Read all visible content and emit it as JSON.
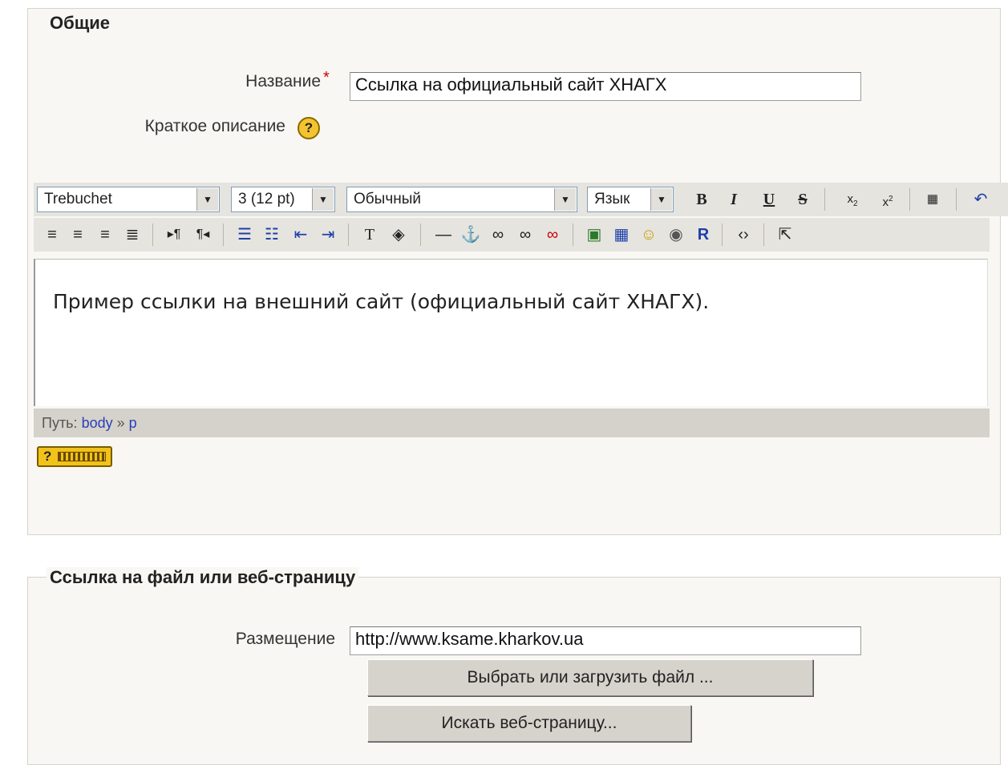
{
  "general": {
    "legend": "Общие",
    "name_label": "Название",
    "required_mark": "*",
    "name_value": "Ссылка на официальный сайт ХНАГХ",
    "summary_label": "Краткое описание",
    "help_glyph": "?"
  },
  "editor": {
    "font_family": "Trebuchet",
    "font_size": "3 (12 pt)",
    "format": "Обычный",
    "language": "Язык",
    "content": "Пример ссылки на внешний сайт (официальный сайт ХНАГХ).",
    "path_label": "Путь:",
    "path_body": "body",
    "path_sep": "»",
    "path_p": "p",
    "toolbar1_icons": [
      "bold-icon",
      "italic-icon",
      "underline-icon",
      "strikethrough-icon",
      "subscript-icon",
      "superscript-icon",
      "paste-word-icon",
      "undo-icon"
    ],
    "toolbar2_icons": [
      "align-left-icon",
      "align-center-icon",
      "align-right-icon",
      "justify-icon",
      "ltr-icon",
      "rtl-icon",
      "ordered-list-icon",
      "unordered-list-icon",
      "outdent-icon",
      "indent-icon",
      "text-color-icon",
      "background-color-icon",
      "horizontal-rule-icon",
      "anchor-icon",
      "link-icon",
      "unlink-icon",
      "no-link-icon",
      "insert-image-icon",
      "insert-table-icon",
      "smiley-icon",
      "search-replace-icon",
      "spellcheck-icon",
      "html-source-icon",
      "fullscreen-icon"
    ]
  },
  "link": {
    "legend": "Ссылка на файл или веб-страницу",
    "location_label": "Размещение",
    "location_value": "http://www.ksame.kharkov.ua",
    "choose_button": "Выбрать или загрузить файл ...",
    "search_button": "Искать веб-страницу..."
  }
}
